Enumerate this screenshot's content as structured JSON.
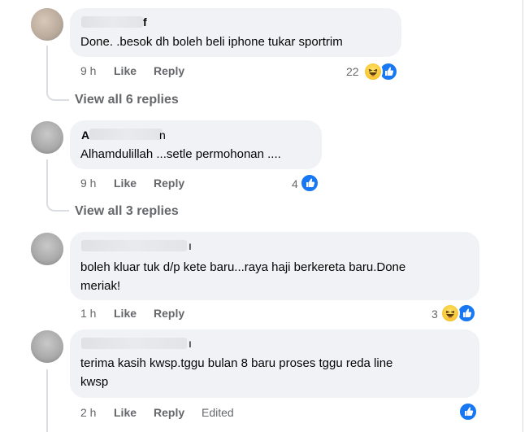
{
  "colors": {
    "bubble_bg": "#f0f2f5",
    "meta_text": "#65676b",
    "like_blue": "#1877f2"
  },
  "comments": [
    {
      "name_fragment": "f",
      "text": "Done. .besok dh boleh beli iphone tukar sportrim",
      "time": "9 h",
      "like_label": "Like",
      "reply_label": "Reply",
      "reaction_count": "22",
      "reaction_icons": [
        "haha-icon",
        "like-icon"
      ],
      "view_replies": "View all 6 replies"
    },
    {
      "name_fragment_start": "A",
      "name_fragment_end": "n",
      "text": "Alhamdulillah ...setle permohonan ....",
      "time": "9 h",
      "like_label": "Like",
      "reply_label": "Reply",
      "reaction_count": "4",
      "reaction_icons": [
        "like-icon"
      ],
      "view_replies": "View all 3 replies"
    },
    {
      "name_fragment": "ı",
      "text_line1": "boleh kluar tuk d/p kete baru...raya haji berkereta baru.Done",
      "text_line2": "meriak!",
      "time": "1 h",
      "like_label": "Like",
      "reply_label": "Reply",
      "reaction_count": "3",
      "reaction_icons": [
        "haha-icon",
        "like-icon"
      ]
    },
    {
      "name_fragment": "ı",
      "text_line1": "terima kasih kwsp.tggu bulan 8 baru proses tggu reda line",
      "text_line2": "kwsp",
      "time": "2 h",
      "like_label": "Like",
      "reply_label": "Reply",
      "edited_label": "Edited",
      "reaction_count": "",
      "reaction_icons": [
        "like-icon"
      ]
    }
  ]
}
